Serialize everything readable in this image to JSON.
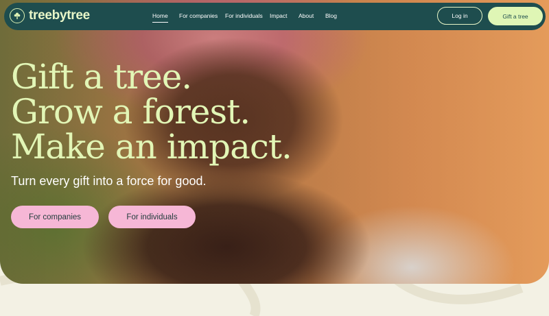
{
  "brand": {
    "name": "treebytree",
    "accent": "#1e4d4e",
    "highlight": "#dff6b5",
    "cta_color": "#f6b7d6"
  },
  "nav": {
    "links": [
      {
        "label": "Home",
        "active": true
      },
      {
        "label": "For companies",
        "active": false
      },
      {
        "label": "For individuals",
        "active": false
      },
      {
        "label": "Impact",
        "active": false
      },
      {
        "label": "About",
        "active": false
      },
      {
        "label": "Blog",
        "active": false
      }
    ],
    "login_label": "Log in",
    "gift_label": "Gift a tree"
  },
  "hero": {
    "headline": [
      "Gift a tree.",
      "Grow a forest.",
      "Make an impact."
    ],
    "subheadline": "Turn every gift into a force for good.",
    "cta_companies": "For companies",
    "cta_individuals": "For individuals",
    "image": "smiling-woman-photo"
  }
}
